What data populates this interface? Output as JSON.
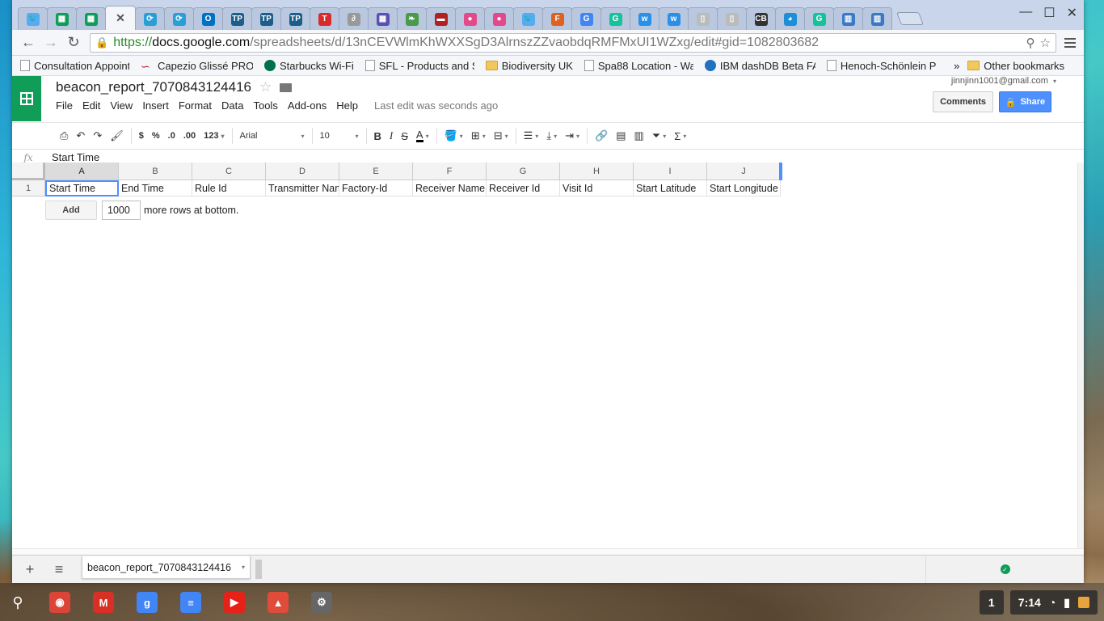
{
  "browser": {
    "tabs": [
      {
        "icon": "twitter-icon",
        "color": "#55acee",
        "glyph": "🐦"
      },
      {
        "icon": "sheets-icon",
        "color": "#0f9d58",
        "glyph": "▦"
      },
      {
        "icon": "sheets-icon",
        "color": "#0f9d58",
        "glyph": "▦"
      },
      {
        "icon": "close-icon",
        "color": "#555",
        "glyph": "✕",
        "active": true
      },
      {
        "icon": "sync-icon",
        "color": "#2a9fd6",
        "glyph": "⟳"
      },
      {
        "icon": "sync-icon",
        "color": "#2a9fd6",
        "glyph": "⟳"
      },
      {
        "icon": "outlook-icon",
        "color": "#0072c6",
        "glyph": "O"
      },
      {
        "icon": "tp-icon",
        "color": "#1c5d8a",
        "glyph": "TP"
      },
      {
        "icon": "tp-icon",
        "color": "#1c5d8a",
        "glyph": "TP"
      },
      {
        "icon": "tp-icon",
        "color": "#1c5d8a",
        "glyph": "TP"
      },
      {
        "icon": "t-icon",
        "color": "#d92b2b",
        "glyph": "T"
      },
      {
        "icon": "link-icon",
        "color": "#999",
        "glyph": "∂"
      },
      {
        "icon": "calendar-icon",
        "color": "#5c4fb0",
        "glyph": "▦"
      },
      {
        "icon": "leaf-icon",
        "color": "#4a9a4a",
        "glyph": "❧"
      },
      {
        "icon": "flag-icon",
        "color": "#b32020",
        "glyph": "▬"
      },
      {
        "icon": "owl-icon",
        "color": "#e24a8a",
        "glyph": "●"
      },
      {
        "icon": "owl-icon",
        "color": "#e24a8a",
        "glyph": "●"
      },
      {
        "icon": "twitter-icon",
        "color": "#55acee",
        "glyph": "🐦"
      },
      {
        "icon": "f-icon",
        "color": "#e06020",
        "glyph": "F"
      },
      {
        "icon": "google-icon",
        "color": "#4285f4",
        "glyph": "G"
      },
      {
        "icon": "grammarly-icon",
        "color": "#15c39a",
        "glyph": "G"
      },
      {
        "icon": "weebly-icon",
        "color": "#2990ea",
        "glyph": "w"
      },
      {
        "icon": "weebly-icon",
        "color": "#2990ea",
        "glyph": "w"
      },
      {
        "icon": "page-icon",
        "color": "#bbb",
        "glyph": "▯"
      },
      {
        "icon": "page-icon",
        "color": "#bbb",
        "glyph": "▯"
      },
      {
        "icon": "cb-icon",
        "color": "#333",
        "glyph": "CB"
      },
      {
        "icon": "pie-icon",
        "color": "#1d8fd8",
        "glyph": "◕"
      },
      {
        "icon": "grammarly-icon",
        "color": "#15c39a",
        "glyph": "G"
      },
      {
        "icon": "layout-icon",
        "color": "#3b78c6",
        "glyph": "▥"
      },
      {
        "icon": "layout-icon",
        "color": "#3b78c6",
        "glyph": "▥"
      }
    ],
    "url": {
      "scheme": "https://",
      "host": "docs.google.com",
      "path": "/spreadsheets/d/13nCEVWlmKhWXXSgD3AlrnszZZvaobdqRMFMxUI1WZxg/edit#gid=1082803682"
    },
    "bookmarks": [
      {
        "label": "Consultation Appoint",
        "type": "page"
      },
      {
        "label": "Capezio Glissé PRO |",
        "type": "capezio"
      },
      {
        "label": "Starbucks Wi-Fi",
        "type": "starbucks"
      },
      {
        "label": "SFL - Products and S",
        "type": "page"
      },
      {
        "label": "Biodiversity UK",
        "type": "folder"
      },
      {
        "label": "Spa88 Location - Wa",
        "type": "page"
      },
      {
        "label": "IBM dashDB Beta FA",
        "type": "ibm"
      },
      {
        "label": "Henoch-Schönlein Pu",
        "type": "page"
      }
    ],
    "bookmarks_overflow": "»",
    "other_bookmarks": "Other bookmarks"
  },
  "docs": {
    "title": "beacon_report_7070843124416",
    "menu": [
      "File",
      "Edit",
      "View",
      "Insert",
      "Format",
      "Data",
      "Tools",
      "Add-ons",
      "Help"
    ],
    "last_edit": "Last edit was seconds ago",
    "account": "jinnjinn1001@gmail.com",
    "comments_label": "Comments",
    "share_label": "Share"
  },
  "toolbar": {
    "currency": "$",
    "percent": "%",
    "dec_decrease": ".0",
    "dec_increase": ".00",
    "more_formats": "123",
    "font": "Arial",
    "font_size": "10",
    "bold": "B",
    "italic": "I",
    "strike": "S",
    "text_color": "A",
    "sum": "Σ"
  },
  "formula": {
    "fx": "fx",
    "value": "Start Time"
  },
  "sheet": {
    "columns": [
      "A",
      "B",
      "C",
      "D",
      "E",
      "F",
      "G",
      "H",
      "I",
      "J"
    ],
    "rows": [
      {
        "num": "1",
        "cells": [
          "Start Time",
          "End Time",
          "Rule Id",
          "Transmitter Nam",
          "Factory-Id",
          "Receiver Name",
          "Receiver Id",
          "Visit Id",
          "Start Latitude",
          "Start Longitude"
        ]
      }
    ],
    "add_label": "Add",
    "add_rows_value": "1000",
    "add_rows_suffix": "more rows at bottom.",
    "tab_name": "beacon_report_7070843124416"
  },
  "shelf": {
    "apps": [
      {
        "icon": "chrome-icon",
        "color": "#db4437",
        "glyph": "◉"
      },
      {
        "icon": "gmail-icon",
        "color": "#d93025",
        "glyph": "M"
      },
      {
        "icon": "google-search-icon",
        "color": "#4285f4",
        "glyph": "g"
      },
      {
        "icon": "docs-icon",
        "color": "#4285f4",
        "glyph": "≡"
      },
      {
        "icon": "youtube-icon",
        "color": "#e62117",
        "glyph": "▶"
      },
      {
        "icon": "photos-icon",
        "color": "#e14c3a",
        "glyph": "▲"
      },
      {
        "icon": "settings-icon",
        "color": "#666",
        "glyph": "⚙"
      }
    ],
    "notification_count": "1",
    "time": "7:14"
  }
}
